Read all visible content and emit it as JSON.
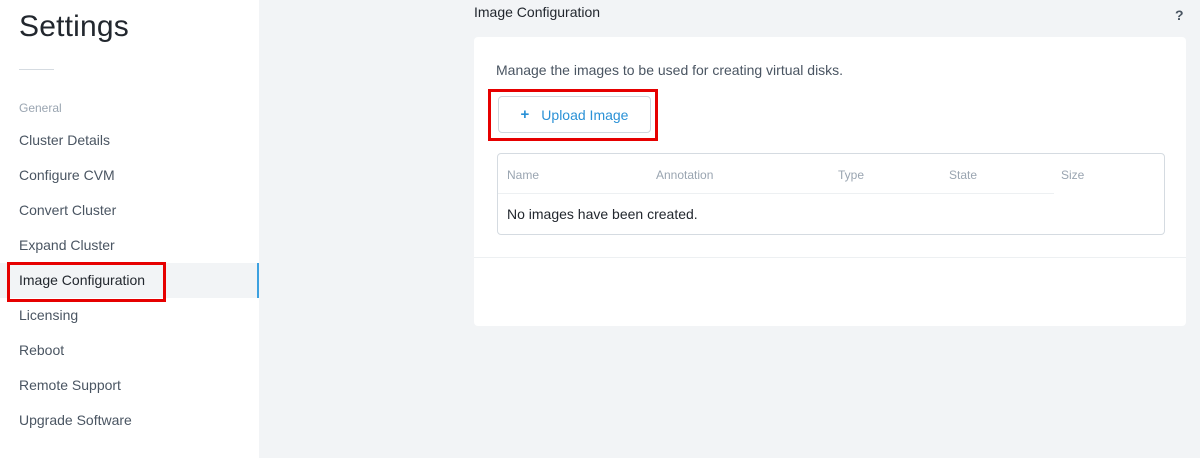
{
  "sidebar": {
    "title": "Settings",
    "section": "General",
    "items": [
      {
        "label": "Cluster Details",
        "active": false
      },
      {
        "label": "Configure CVM",
        "active": false
      },
      {
        "label": "Convert Cluster",
        "active": false
      },
      {
        "label": "Expand Cluster",
        "active": false
      },
      {
        "label": "Image Configuration",
        "active": true
      },
      {
        "label": "Licensing",
        "active": false
      },
      {
        "label": "Reboot",
        "active": false
      },
      {
        "label": "Remote Support",
        "active": false
      },
      {
        "label": "Upgrade Software",
        "active": false
      }
    ]
  },
  "main": {
    "title": "Image Configuration",
    "help": "?",
    "description": "Manage the images to be used for creating virtual disks.",
    "upload_button": {
      "icon": "plus-icon",
      "label": "Upload Image"
    },
    "table": {
      "columns": [
        "Name",
        "Annotation",
        "Type",
        "State",
        "Size"
      ],
      "empty_message": "No images have been created."
    }
  },
  "colors": {
    "accent": "#2a91d6",
    "highlight": "#e60000",
    "active_bar": "#3da1e0",
    "background": "#f2f4f6"
  }
}
